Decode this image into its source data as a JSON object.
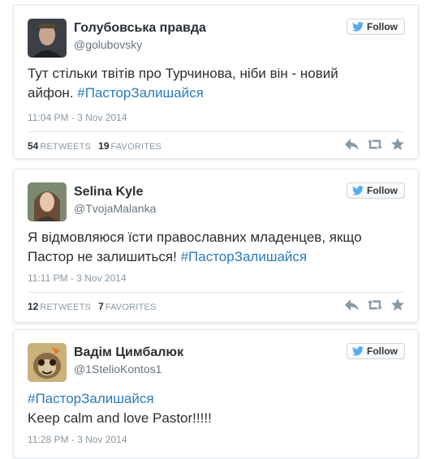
{
  "colors": {
    "hashtag": "#2b7bb9",
    "name": "#292f33",
    "meta": "#8899a6",
    "twitter_blue": "#55acee"
  },
  "follow_label": "Follow",
  "tweets": [
    {
      "author_name": "Голубовська правда",
      "handle": "@golubovsky",
      "text": "Тут стільки твітів про Турчинова, ніби він - новий айфон. ",
      "hashtag": "#ПасторЗалишайся",
      "timestamp": "11:04 PM - 3 Nov 2014",
      "retweets_count": "54",
      "retweets_label": "RETWEETS",
      "favorites_count": "19",
      "favorites_label": "FAVORITES"
    },
    {
      "author_name": "Selina Kyle",
      "handle": "@TvojaMalanka",
      "text": "Я відмовляюся їсти православних младенцев, якщо Пастор не залишиться! ",
      "hashtag": "#ПасторЗалишайся",
      "timestamp": "11:11 PM - 3 Nov 2014",
      "retweets_count": "12",
      "retweets_label": "RETWEETS",
      "favorites_count": "7",
      "favorites_label": "FAVORITES"
    },
    {
      "author_name": "Вадім Цимбалюк",
      "handle": "@1StelioKontos1",
      "hashtag": "#ПасторЗалишайся",
      "text": "Keep calm and love Pastor!!!!!",
      "timestamp": "11:28 PM - 3 Nov 2014"
    }
  ],
  "icons": {
    "bird": "twitter-bird-icon",
    "reply": "reply-icon",
    "retweet": "retweet-icon",
    "favorite": "star-icon"
  }
}
